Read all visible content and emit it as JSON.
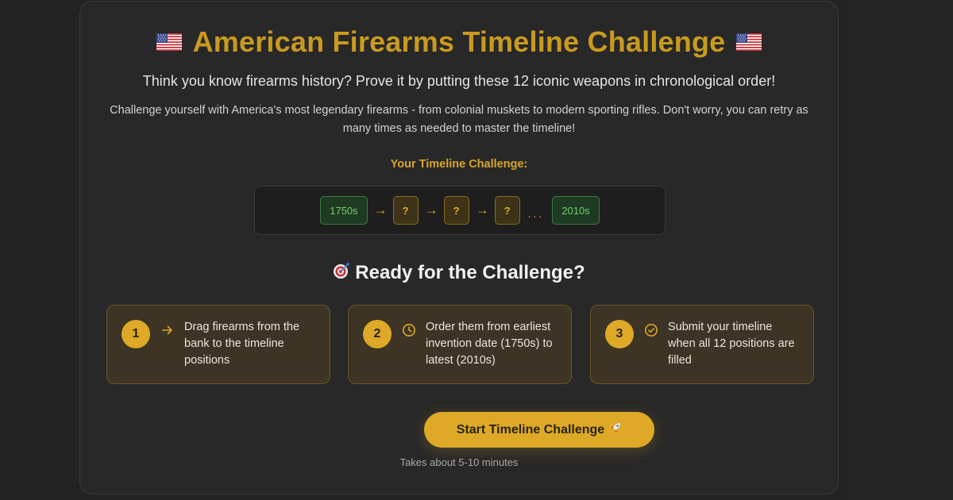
{
  "title": "American Firearms Timeline Challenge",
  "subtitle": "Think you know firearms history? Prove it by putting these 12 iconic weapons in chronological order!",
  "description": "Challenge yourself with America's most legendary firearms - from colonial muskets to modern sporting rifles. Don't worry, you can retry as many times as needed to master the timeline!",
  "timeline_preview": {
    "label": "Your Timeline Challenge:",
    "start": "1750s",
    "placeholder": "?",
    "arrow": "→",
    "ellipsis": "...",
    "end": "2010s"
  },
  "ready": {
    "emoji": "🎯",
    "title": "Ready for the Challenge?"
  },
  "steps": [
    {
      "number": "1",
      "icon": "arrow-right-icon",
      "text": "Drag firearms from the bank to the timeline positions"
    },
    {
      "number": "2",
      "icon": "clock-icon",
      "text": "Order them from earliest invention date (1750s) to latest (2010s)"
    },
    {
      "number": "3",
      "icon": "check-circle-icon",
      "text": "Submit your timeline when all 12 positions are filled"
    }
  ],
  "start_button": {
    "label": "Start Timeline Challenge",
    "emoji": "🚀"
  },
  "time_note": "Takes about 5-10 minutes",
  "colors": {
    "accent": "#dda927",
    "title_gold": "#c99a1f",
    "background": "#232323",
    "card": "#282828",
    "year_green": "#6fcf6a"
  }
}
